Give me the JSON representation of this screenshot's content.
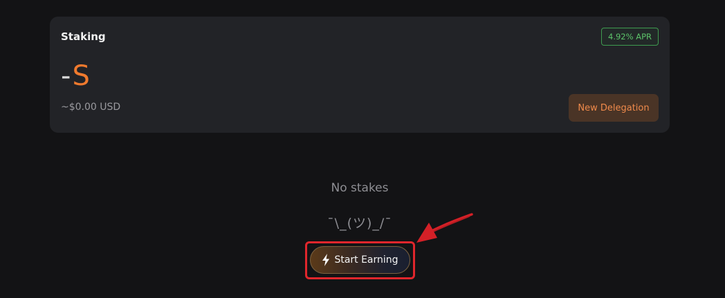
{
  "staking_card": {
    "title": "Staking",
    "apr_badge": "4.92% APR",
    "balance_dash": "-",
    "balance_symbol": "S",
    "usd_value": "~$0.00 USD",
    "new_delegation_label": "New Delegation"
  },
  "empty_state": {
    "message": "No stakes",
    "shrug": "¯\\_(ツ)_/¯",
    "start_earning_label": "Start Earning"
  },
  "colors": {
    "background": "#131315",
    "card": "#222327",
    "accent_orange": "#f07a2e",
    "apr_green": "#5cc46a",
    "annotation_red": "#e0262c"
  },
  "icons": {
    "start_earning": "lightning-bolt-icon",
    "annotation": "red-arrow-icon"
  }
}
